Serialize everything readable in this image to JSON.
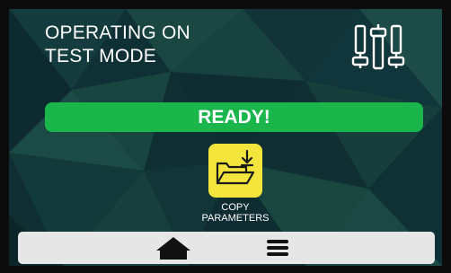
{
  "header": {
    "title_line1": "OPERATING ON",
    "title_line2": "TEST MODE",
    "settings_icon": "sliders-icon"
  },
  "status": {
    "text": "READY!",
    "color": "#1ab54b"
  },
  "copy_parameters": {
    "icon": "folder-download-icon",
    "label_line1": "COPY",
    "label_line2": "PARAMETERS",
    "button_color": "#f3e53b"
  },
  "bottom_nav": {
    "home_icon": "home-icon",
    "menu_icon": "hamburger-menu-icon",
    "background": "#e6e6e6"
  },
  "theme": {
    "background_primary": "#0f2f33",
    "background_secondary": "#1c4a44"
  }
}
